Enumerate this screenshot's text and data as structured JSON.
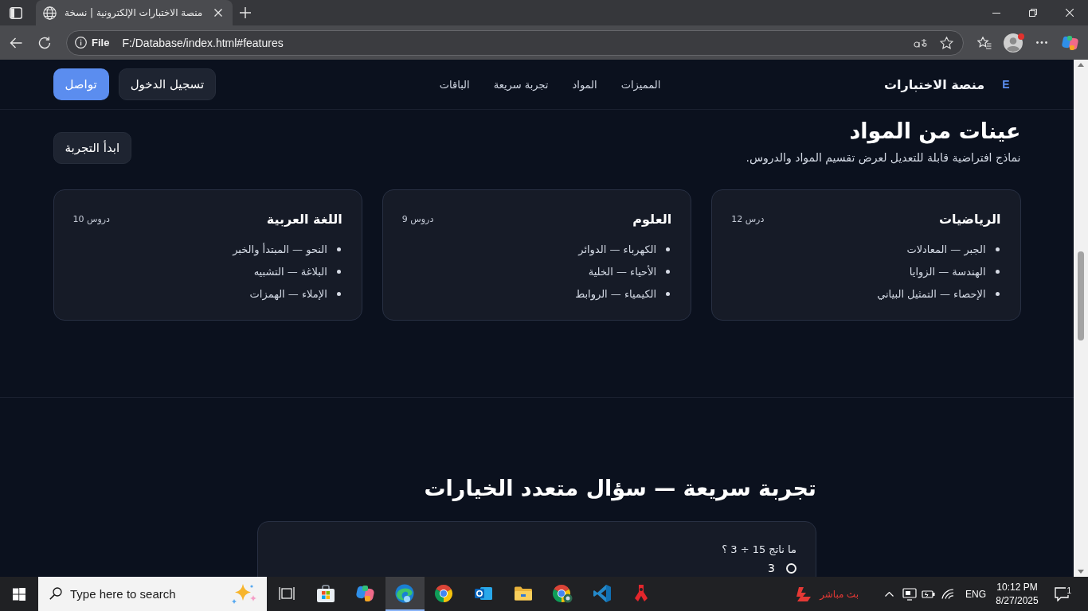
{
  "browser": {
    "tabs": [
      {
        "title": "منصة الاختبارات الإلكترونية | نسخة",
        "selected": true
      }
    ],
    "address_bar": {
      "site_info": "File",
      "url": "F:/Database/index.html#features"
    }
  },
  "site_header": {
    "logo_mark": "E",
    "brand": "منصة الاختبارات",
    "nav": [
      "المميزات",
      "المواد",
      "تجربة سريعة",
      "الباقات"
    ],
    "buttons": [
      {
        "label": "تسجيل الدخول",
        "kind": "secondary"
      },
      {
        "label": "تواصل",
        "kind": "primary"
      }
    ]
  },
  "subjects_section": {
    "title": "عينات من المواد",
    "subtitle": "نماذج افتراضية قابلة للتعديل لعرض تقسيم المواد والدروس.",
    "cta": "ابدأ التجربة",
    "cards": [
      {
        "title": "الرياضيات",
        "count": "12 درس",
        "lessons": [
          "الجبر — المعادلات",
          "الهندسة — الزوايا",
          "الإحصاء — التمثيل البياني"
        ]
      },
      {
        "title": "العلوم",
        "count": "9 دروس",
        "lessons": [
          "الكهرباء — الدوائر",
          "الأحياء — الخلية",
          "الكيمياء — الروابط"
        ]
      },
      {
        "title": "اللغة العربية",
        "count": "10 دروس",
        "lessons": [
          "النحو — المبتدأ والخبر",
          "البلاغة — التشبيه",
          "الإملاء — الهمزات"
        ]
      }
    ]
  },
  "quiz_section": {
    "title": "تجربة سريعة — سؤال متعدد الخيارات",
    "question": "ما ناتج 15 ÷ 3 ؟",
    "options": [
      {
        "label": "3",
        "selected": false
      }
    ]
  },
  "taskbar": {
    "search": {
      "placeholder": "Type here to search"
    },
    "apps": [
      {
        "kind": "taskview",
        "selected": false
      },
      {
        "kind": "store",
        "selected": false
      },
      {
        "kind": "assistant",
        "selected": false
      },
      {
        "kind": "swirl",
        "selected": true
      },
      {
        "kind": "wheel",
        "selected": false
      },
      {
        "kind": "mail",
        "selected": false
      },
      {
        "kind": "folder",
        "selected": false
      },
      {
        "kind": "wheelprofile",
        "selected": false
      },
      {
        "kind": "editor",
        "selected": false
      },
      {
        "kind": "tool",
        "selected": false
      }
    ],
    "tray": {
      "live_label": "بث مباشر",
      "language": "ENG",
      "time": "10:12 PM",
      "date": "8/27/2025",
      "notification_count": "1"
    }
  }
}
